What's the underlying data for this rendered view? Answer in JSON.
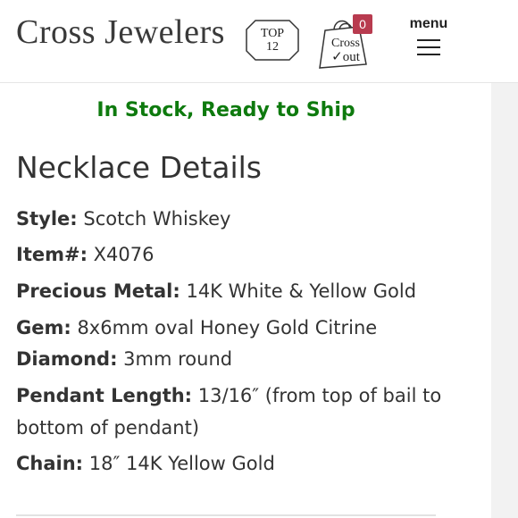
{
  "header": {
    "brand": "Cross Jewelers",
    "top12": {
      "line1": "TOP",
      "line2": "12"
    },
    "bag": {
      "line1": "Cross",
      "line2": "out",
      "check": "✓",
      "count": "0"
    },
    "menu_label": "menu"
  },
  "content": {
    "stock_status": "In Stock, Ready to Ship",
    "title": "Necklace Details",
    "details": [
      {
        "label": "Style:",
        "value": " Scotch Whiskey"
      },
      {
        "label": "Item#:",
        "value": " X4076"
      },
      {
        "label": "Precious Metal:",
        "value": " 14K White & Yellow Gold"
      },
      {
        "label": "Gem:",
        "value": " 8x6mm oval Honey Gold Citrine"
      },
      {
        "label": "Diamond:",
        "value": " 3mm round"
      },
      {
        "label": "Pendant Length:",
        "value": " 13/16″ (from top of bail to bottom of pendant)"
      },
      {
        "label": "Chain:",
        "value": " 18″  14K Yellow Gold"
      }
    ]
  },
  "colors": {
    "stock_green": "#0e7a0e",
    "badge_red": "#b83b4f"
  }
}
